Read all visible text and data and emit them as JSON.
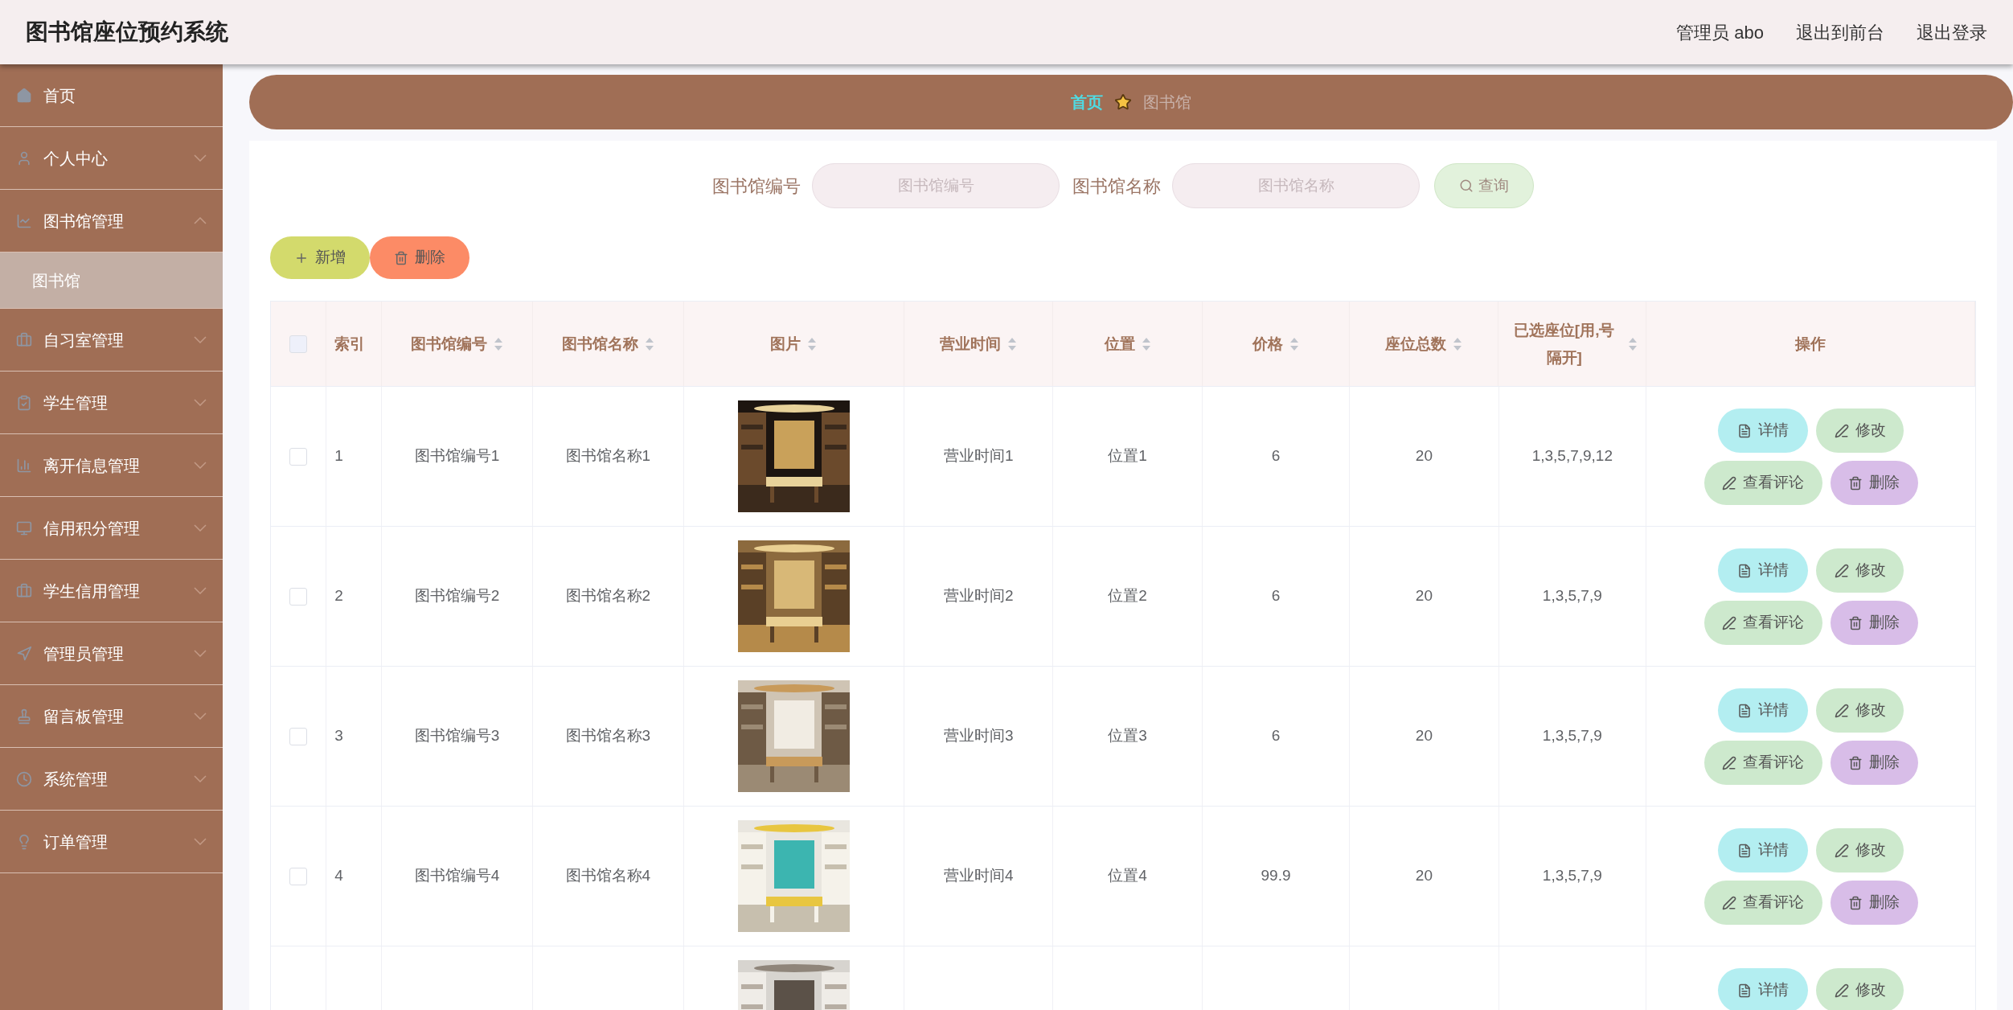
{
  "header": {
    "title": "图书馆座位预约系统",
    "user": "管理员 abo",
    "links": [
      "退出到前台",
      "退出登录"
    ]
  },
  "sidebar": {
    "items": [
      {
        "label": "首页",
        "kind": "link"
      },
      {
        "label": "个人中心",
        "kind": "menu",
        "expanded": false
      },
      {
        "label": "图书馆管理",
        "kind": "menu",
        "expanded": true,
        "children": [
          {
            "label": "图书馆",
            "selected": true
          }
        ]
      },
      {
        "label": "自习室管理",
        "kind": "menu",
        "expanded": false
      },
      {
        "label": "学生管理",
        "kind": "menu",
        "expanded": false
      },
      {
        "label": "离开信息管理",
        "kind": "menu",
        "expanded": false
      },
      {
        "label": "信用积分管理",
        "kind": "menu",
        "expanded": false
      },
      {
        "label": "学生信用管理",
        "kind": "menu",
        "expanded": false
      },
      {
        "label": "管理员管理",
        "kind": "menu",
        "expanded": false
      },
      {
        "label": "留言板管理",
        "kind": "menu",
        "expanded": false
      },
      {
        "label": "系统管理",
        "kind": "menu",
        "expanded": false
      },
      {
        "label": "订单管理",
        "kind": "menu",
        "expanded": false
      }
    ]
  },
  "breadcrumb": [
    "首页",
    "图书馆"
  ],
  "search": {
    "fields": [
      {
        "label": "图书馆编号",
        "placeholder": "图书馆编号"
      },
      {
        "label": "图书馆名称",
        "placeholder": "图书馆名称"
      }
    ],
    "button": "查询"
  },
  "toolbar": [
    {
      "label": "新增",
      "kind": "add"
    },
    {
      "label": "删除",
      "kind": "delete"
    }
  ],
  "table": {
    "header_checked": false,
    "columns": [
      {
        "label": "索引",
        "sortable": false
      },
      {
        "label": "图书馆编号",
        "sortable": true
      },
      {
        "label": "图书馆名称",
        "sortable": true
      },
      {
        "label": "图片",
        "sortable": true
      },
      {
        "label": "营业时间",
        "sortable": true
      },
      {
        "label": "位置",
        "sortable": true
      },
      {
        "label": "价格",
        "sortable": true
      },
      {
        "label": "座位总数",
        "sortable": true
      },
      {
        "label": "已选座位[用,号隔开]",
        "sortable": true
      },
      {
        "label": "操作",
        "sortable": false
      }
    ],
    "rows": [
      {
        "checked": false,
        "cells": [
          "1",
          "图书馆编号1",
          "图书馆名称1",
          {
            "kind": "picture"
          },
          "营业时间1",
          "位置1",
          "6",
          "20",
          "1,3,5,7,9,12"
        ],
        "actions": [
          {
            "label": "详情",
            "kind": "detail"
          },
          {
            "label": "修改",
            "kind": "edit"
          },
          {
            "label": "查看评论",
            "kind": "comment"
          },
          {
            "label": "删除",
            "kind": "delete"
          }
        ]
      },
      {
        "checked": false,
        "cells": [
          "2",
          "图书馆编号2",
          "图书馆名称2",
          {
            "kind": "picture"
          },
          "营业时间2",
          "位置2",
          "6",
          "20",
          "1,3,5,7,9"
        ],
        "actions": [
          {
            "label": "详情",
            "kind": "detail"
          },
          {
            "label": "修改",
            "kind": "edit"
          },
          {
            "label": "查看评论",
            "kind": "comment"
          },
          {
            "label": "删除",
            "kind": "delete"
          }
        ]
      },
      {
        "checked": false,
        "cells": [
          "3",
          "图书馆编号3",
          "图书馆名称3",
          {
            "kind": "picture"
          },
          "营业时间3",
          "位置3",
          "6",
          "20",
          "1,3,5,7,9"
        ],
        "actions": [
          {
            "label": "详情",
            "kind": "detail"
          },
          {
            "label": "修改",
            "kind": "edit"
          },
          {
            "label": "查看评论",
            "kind": "comment"
          },
          {
            "label": "删除",
            "kind": "delete"
          }
        ]
      },
      {
        "checked": false,
        "cells": [
          "4",
          "图书馆编号4",
          "图书馆名称4",
          {
            "kind": "picture"
          },
          "营业时间4",
          "位置4",
          "99.9",
          "20",
          "1,3,5,7,9"
        ],
        "actions": [
          {
            "label": "详情",
            "kind": "detail"
          },
          {
            "label": "修改",
            "kind": "edit"
          },
          {
            "label": "查看评论",
            "kind": "comment"
          },
          {
            "label": "删除",
            "kind": "delete"
          }
        ]
      },
      {
        "cells": [
          "",
          "",
          "",
          {
            "kind": "picture"
          },
          "",
          "",
          "",
          "",
          ""
        ],
        "actions": [
          {
            "label": "详情",
            "kind": "detail"
          },
          {
            "label": "修改",
            "kind": "edit"
          }
        ]
      }
    ]
  }
}
